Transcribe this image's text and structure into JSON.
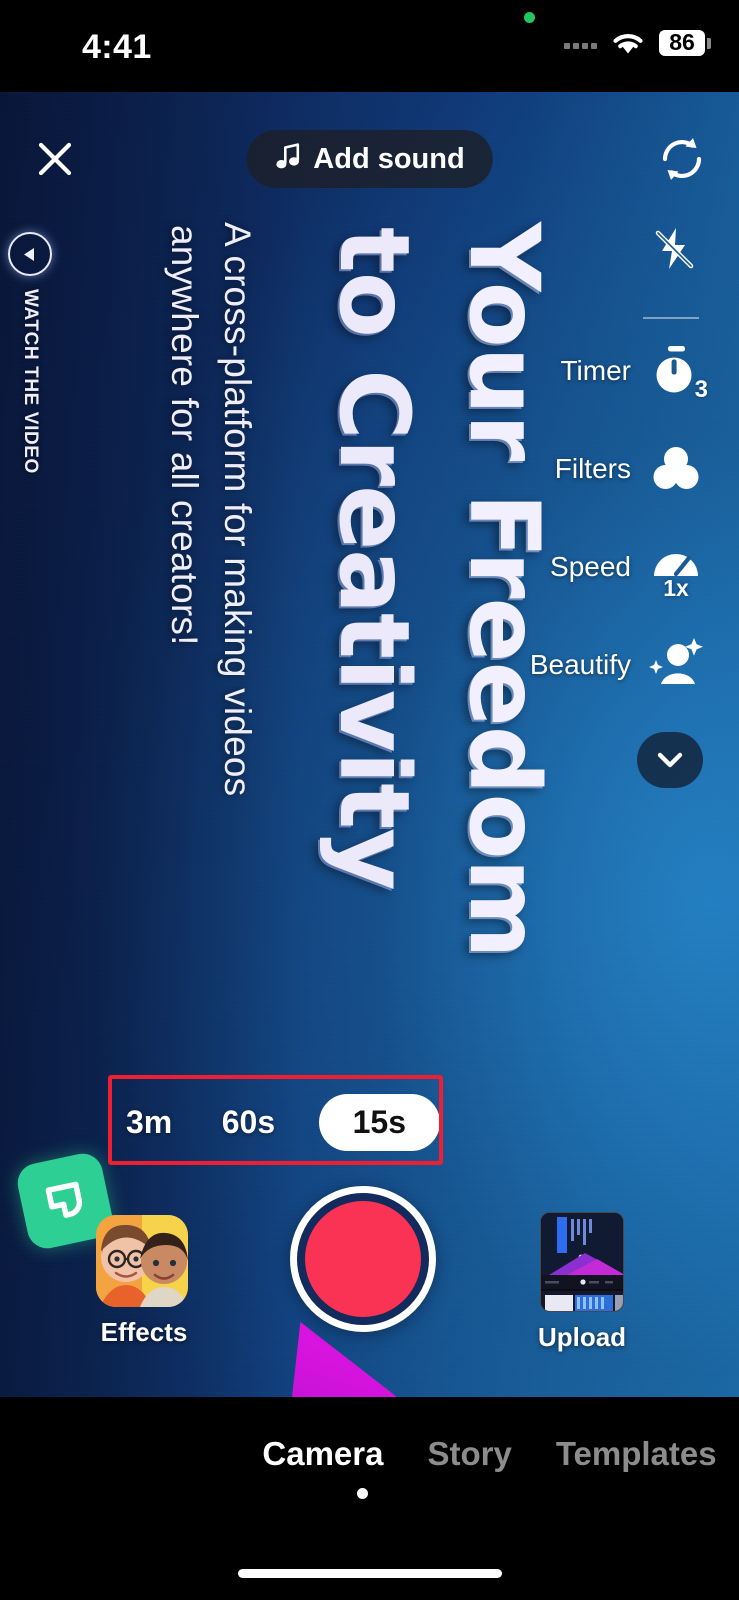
{
  "status_bar": {
    "time": "4:41",
    "battery_percent": "86",
    "recording_dot": "green-recording-indicator",
    "wifi_icon": "wifi-icon",
    "signal_icon": "signal-dots-icon"
  },
  "top_bar": {
    "close_icon": "close-x-icon",
    "add_sound_label": "Add sound",
    "music_icon": "music-note-icon",
    "flip_camera_icon": "camera-flip-icon"
  },
  "camera_overlay": {
    "headline_line1": "Your Freedom",
    "headline_line2": "to Creativity",
    "tagline": "A cross-platform for making videos anywhere for all creators!",
    "watch_label": "WATCH THE VIDEO",
    "play_icon": "play-circle-icon"
  },
  "tool_rail": {
    "flash_icon": "flash-off-icon",
    "collapse_icon": "chevron-down-icon",
    "items": [
      {
        "label": "Timer",
        "icon": "timer-stopwatch-icon",
        "badge": "3"
      },
      {
        "label": "Filters",
        "icon": "filters-circles-icon",
        "badge": ""
      },
      {
        "label": "Speed",
        "icon": "speed-gauge-icon",
        "badge": "1x"
      },
      {
        "label": "Beautify",
        "icon": "beautify-person-icon",
        "badge": ""
      }
    ]
  },
  "duration_selector": {
    "options": [
      {
        "label": "3m",
        "selected": false
      },
      {
        "label": "60s",
        "selected": false
      },
      {
        "label": "15s",
        "selected": true
      }
    ],
    "highlight_color": "#ee1f32"
  },
  "bottom_controls": {
    "app_icon": "green-app-launcher-icon",
    "effects_label": "Effects",
    "effects_icon": "effects-avatars-thumbnail",
    "record_label": "record-button",
    "record_color": "#fa3254",
    "upload_label": "Upload",
    "upload_icon": "upload-gallery-thumbnail"
  },
  "tab_bar": {
    "tabs": [
      {
        "label": "Camera",
        "active": true
      },
      {
        "label": "Story",
        "active": false
      },
      {
        "label": "Templates",
        "active": false
      }
    ]
  }
}
